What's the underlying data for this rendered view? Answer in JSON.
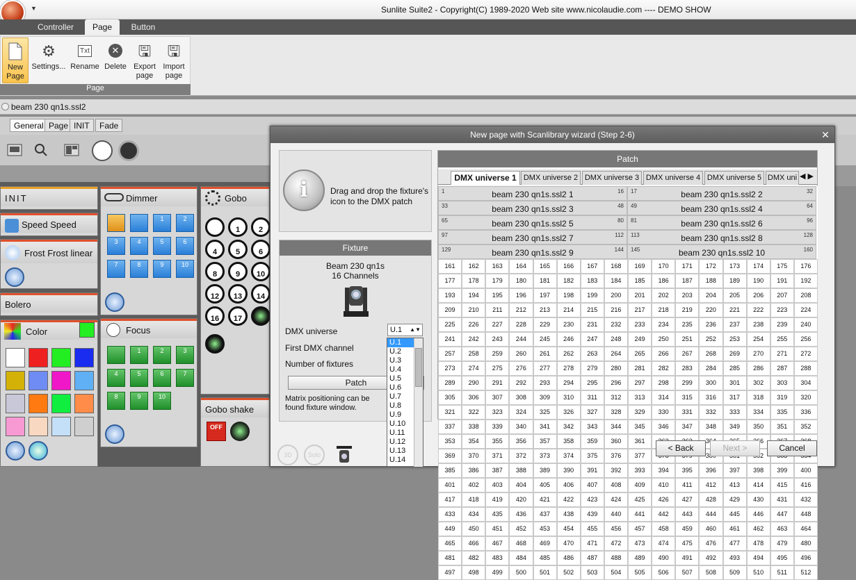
{
  "window": {
    "title": "Sunlite Suite2 - Copyright(C) 1989-2020    Web site www.nicolaudie.com ---- DEMO SHOW"
  },
  "ribbon": {
    "tabs": [
      "Controller",
      "Page",
      "Button"
    ],
    "active_tab": "Page",
    "buttons": [
      {
        "label": "New Page",
        "icon": "new-page-icon"
      },
      {
        "label": "Settings...",
        "icon": "gear-icon"
      },
      {
        "label": "Rename",
        "icon": "rename-icon"
      },
      {
        "label": "Delete",
        "icon": "delete-icon"
      },
      {
        "label": "Export page",
        "icon": "export-icon"
      },
      {
        "label": "Import page",
        "icon": "import-icon"
      }
    ],
    "group_label": "Page"
  },
  "file": {
    "name": "beam 230 qn1s.ssl2"
  },
  "page_tabs": [
    "General",
    "Page",
    "INIT",
    "Fade"
  ],
  "panels": {
    "init": "INIT",
    "speed": "Speed Speed",
    "frost": "Frost Frost linear",
    "bolero": "Bolero",
    "color": "Color",
    "dimmer": "Dimmer",
    "focus": "Focus",
    "gobo": "Gobo",
    "gobo_shake": "Gobo shake",
    "dimmer_cues": [
      "",
      "",
      "1",
      "2",
      "3",
      "4",
      "5",
      "6",
      "7",
      "8",
      "9",
      "10"
    ],
    "focus_cues": [
      "",
      "1",
      "2",
      "3",
      "4",
      "5",
      "6",
      "7",
      "8",
      "9",
      "10"
    ],
    "gobos": [
      "",
      "1",
      "2",
      "4",
      "5",
      "6",
      "8",
      "9",
      "10",
      "12",
      "13",
      "14",
      "16",
      "17",
      ""
    ],
    "colors": [
      "#ffffff",
      "#ee2020",
      "#22ee22",
      "#1a2cf0",
      "#d4b106",
      "#6f8cf4",
      "#ef17c8",
      "#5fb0f5",
      "#c8c8d8",
      "#ff7a10",
      "#10ee40",
      "#ff8c48",
      "#f79ad4",
      "#f8d8c0",
      "#c4e0f8",
      "#cfcfcf"
    ]
  },
  "dialog": {
    "title": "New page with Scanlibrary wizard (Step 2-6)",
    "info": "Drag and drop the fixture's icon to the DMX patch",
    "fixture": {
      "header": "Fixture",
      "name": "Beam 230 qn1s",
      "channels": "16 Channels",
      "dmx_universe_label": "DMX universe",
      "dmx_universe_value": "U.1",
      "first_channel_label": "First DMX channel",
      "number_label": "Number of fixtures",
      "patch_button": "Patch",
      "matrix_note": "Matrix positioning can be found fixture window."
    },
    "universe_options": [
      "U.1",
      "U.2",
      "U.3",
      "U.4",
      "U.5",
      "U.6",
      "U.7",
      "U.8",
      "U.9",
      "U.10",
      "U.11",
      "U.12",
      "U.13",
      "U.14"
    ],
    "patch": {
      "header": "Patch",
      "tabs": [
        "DMX universe 1",
        "DMX universe 2",
        "DMX universe 3",
        "DMX universe 4",
        "DMX universe 5",
        "DMX uni"
      ],
      "active_tab": "DMX universe 1",
      "fixtures": [
        {
          "start": "1",
          "end": "16",
          "label": "beam 230 qn1s.ssl2  1"
        },
        {
          "start": "17",
          "end": "32",
          "label": "beam 230 qn1s.ssl2  2"
        },
        {
          "start": "33",
          "end": "48",
          "label": "beam 230 qn1s.ssl2  3"
        },
        {
          "start": "49",
          "end": "64",
          "label": "beam 230 qn1s.ssl2  4"
        },
        {
          "start": "65",
          "end": "80",
          "label": "beam 230 qn1s.ssl2  5"
        },
        {
          "start": "81",
          "end": "96",
          "label": "beam 230 qn1s.ssl2  6"
        },
        {
          "start": "97",
          "end": "112",
          "label": "beam 230 qn1s.ssl2  7"
        },
        {
          "start": "113",
          "end": "128",
          "label": "beam 230 qn1s.ssl2  8"
        },
        {
          "start": "129",
          "end": "144",
          "label": "beam 230 qn1s.ssl2  9"
        },
        {
          "start": "145",
          "end": "160",
          "label": "beam 230 qn1s.ssl2 10"
        }
      ],
      "free_start": 161,
      "free_end": 512
    },
    "buttons": {
      "back": "< Back",
      "next": "Next >",
      "cancel": "Cancel"
    },
    "bottom_icons": [
      "3D",
      "Solo"
    ]
  }
}
